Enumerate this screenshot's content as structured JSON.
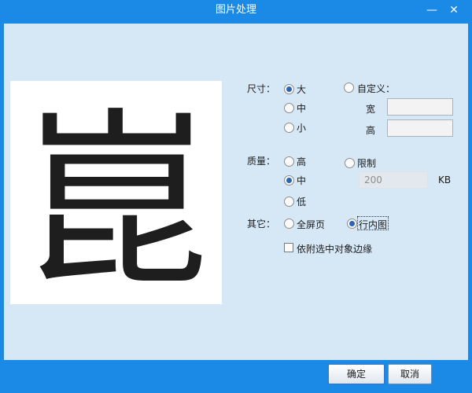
{
  "window": {
    "title": "图片处理",
    "minimize_label": "—",
    "close_label": "✕"
  },
  "preview": {
    "glyph": "崑",
    "icon": "preview-image"
  },
  "size": {
    "label": "尺寸：",
    "options": [
      "大",
      "中",
      "小"
    ],
    "selected": "大",
    "custom_label": "自定义：",
    "width_label": "宽",
    "height_label": "高",
    "width_value": "",
    "height_value": ""
  },
  "quality": {
    "label": "质量：",
    "options": [
      "高",
      "中",
      "低"
    ],
    "selected": "中",
    "limit_label": "限制",
    "limit_value": "200",
    "limit_unit": "KB"
  },
  "other": {
    "label": "其它：",
    "options": [
      "全屏页",
      "行内图"
    ],
    "selected": "行内图",
    "checkbox_label": "依附选中对象边缘",
    "checkbox_checked": false
  },
  "footer": {
    "ok_label": "确定",
    "cancel_label": "取消"
  }
}
